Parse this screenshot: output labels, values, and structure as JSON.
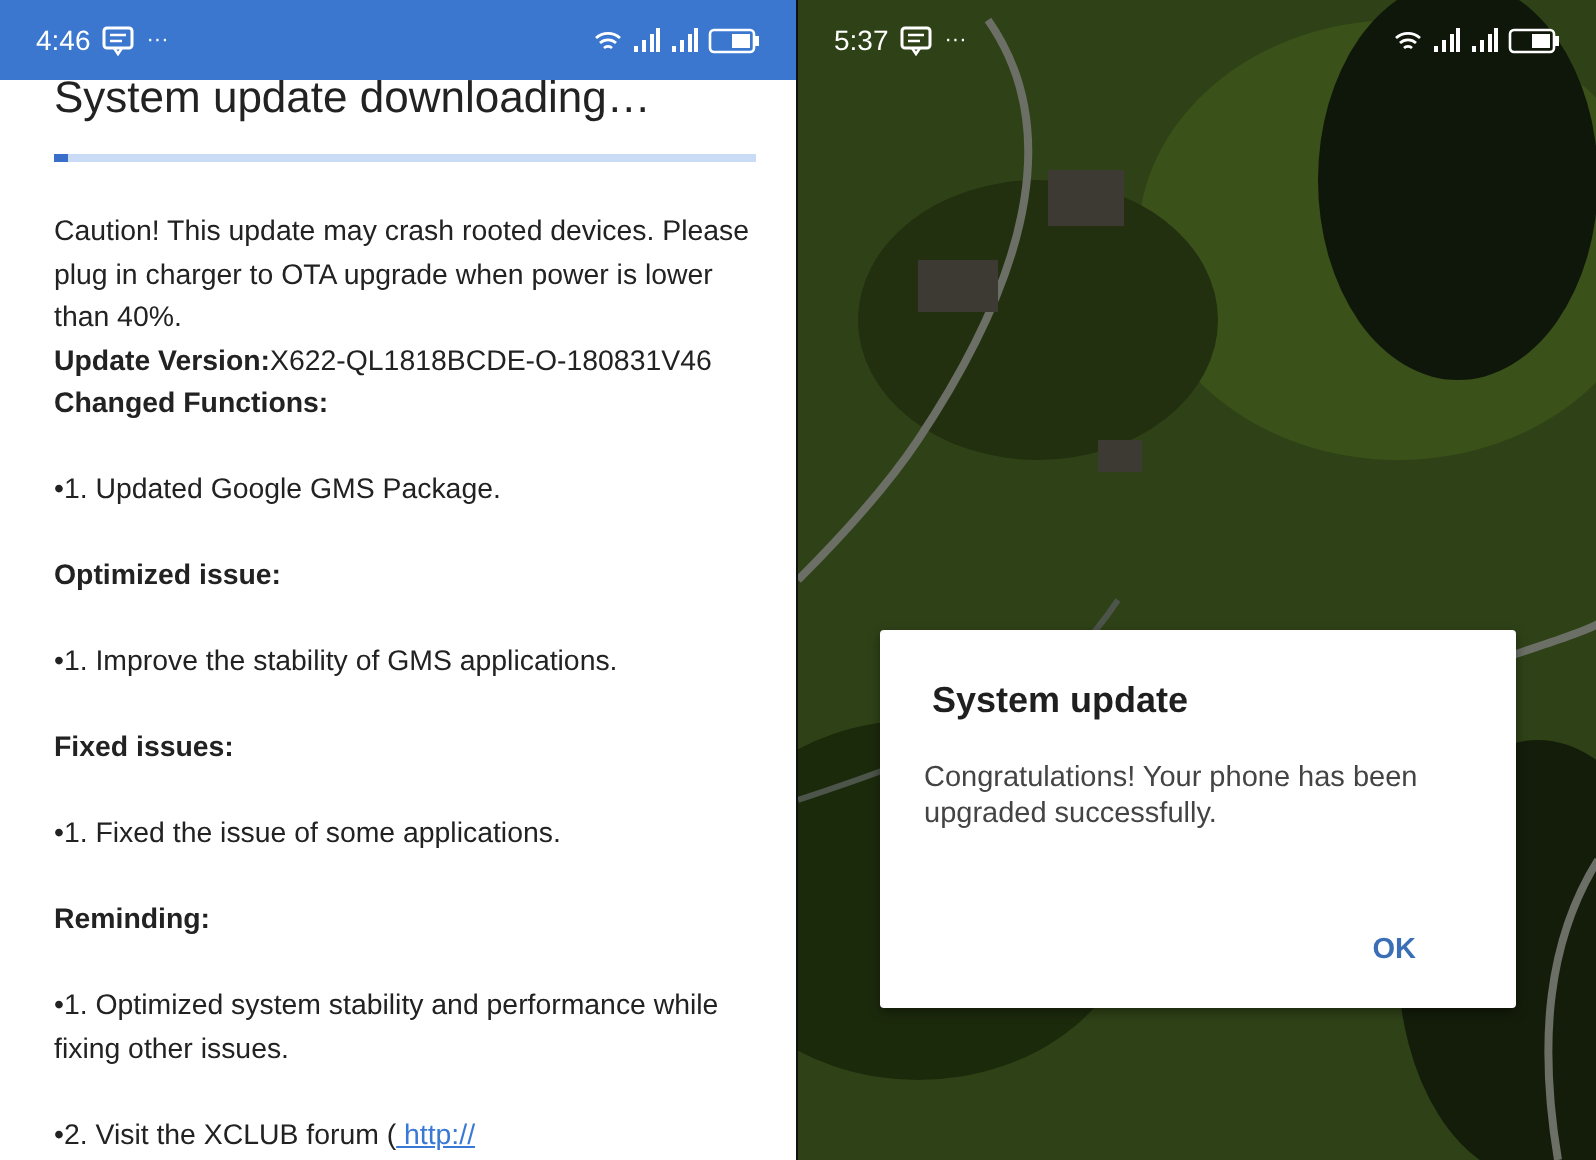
{
  "left_screen": {
    "status_bar": {
      "time": "4:46",
      "more": "···"
    },
    "title": "System update downloading…",
    "progress": {
      "level": 0.02
    },
    "notes": [
      {
        "kind": "text",
        "text": "Caution! This update may crash rooted devices. Please plug in charger to OTA upgrade when power is lower than 40%."
      },
      {
        "kind": "text",
        "text": "**Update Version:**X622-QL1818BCDE-O-180831V46"
      },
      {
        "kind": "heading",
        "text": "Changed Functions:"
      }
    ],
    "sections": [
      {
        "kind": "item",
        "text": "•1. Updated Google GMS Package."
      },
      {
        "kind": "heading",
        "text": "Optimized issue:"
      },
      {
        "kind": "item",
        "text": "•1. Improve the stability of GMS applications."
      },
      {
        "kind": "heading",
        "text": "Fixed issues:"
      },
      {
        "kind": "item",
        "text": "•1. Fixed the issue of some applications."
      },
      {
        "kind": "heading",
        "text": "Reminding:"
      },
      {
        "kind": "item",
        "text": "•1. Optimized system stability and performance while fixing other issues."
      },
      {
        "kind": "link_item",
        "text": "•2. Visit the XCLUB forum (",
        "link": " http://"
      }
    ]
  },
  "right_screen": {
    "status_bar": {
      "time": "5:37",
      "more": "···"
    },
    "dialog": {
      "title": "System update",
      "message": "Congratulations! Your phone has been upgraded successfully.",
      "buttons": [
        "OK"
      ]
    }
  }
}
